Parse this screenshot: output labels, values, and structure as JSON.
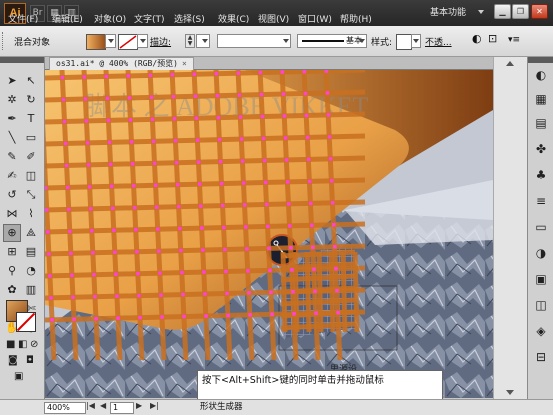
{
  "app": {
    "logo": "Ai",
    "workspace": "基本功能",
    "window_buttons": [
      "minimize",
      "restore",
      "close"
    ]
  },
  "menu": [
    "文件(F)",
    "编辑(E)",
    "对象(O)",
    "文字(T)",
    "选择(S)",
    "效果(C)",
    "视图(V)",
    "窗口(W)",
    "帮助(H)"
  ],
  "control_bar": {
    "object_label": "混合对象",
    "stroke_label": "描边:",
    "brush_label": "基本",
    "style_label": "样式:",
    "opacity_link": "不透..."
  },
  "document": {
    "tab_title": "os31.ai* @ 400% (RGB/预览)",
    "close_glyph": "×"
  },
  "canvas": {
    "cursor_label": "思源设"
  },
  "instruction": "按下<Alt+Shift>键的同时单击并拖动鼠标",
  "status": {
    "zoom": "400%",
    "page": "1",
    "tool": "形状生成器"
  },
  "colors": {
    "grid_stroke": "#c97020",
    "anchor": "#ff44d0",
    "orange_light": "#f5b75a",
    "orange_dark": "#8d4a18",
    "menubar": "#2e2e2e"
  }
}
